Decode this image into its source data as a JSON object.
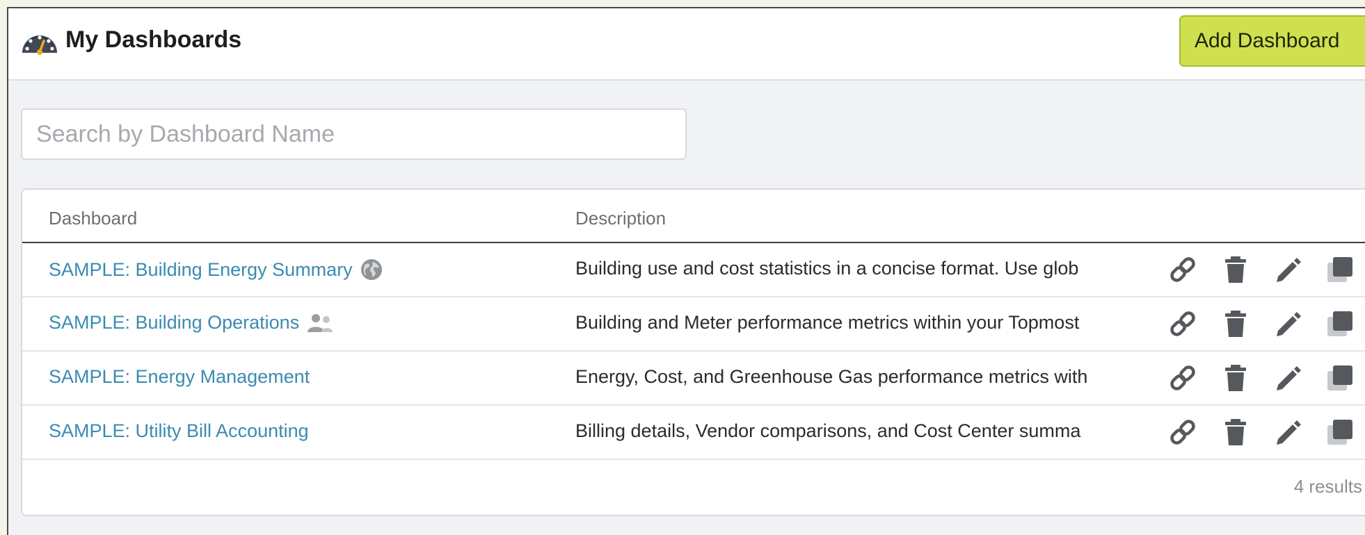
{
  "header": {
    "title": "My Dashboards",
    "add_button_label": "Add Dashboard"
  },
  "search": {
    "placeholder": "Search by Dashboard Name",
    "value": ""
  },
  "table": {
    "columns": [
      "Dashboard",
      "Description"
    ],
    "rows": [
      {
        "name": "SAMPLE: Building Energy Summary",
        "badge_icon": "globe-icon",
        "description": "Building use and cost statistics in a concise format. Use glob"
      },
      {
        "name": "SAMPLE: Building Operations",
        "badge_icon": "users-icon",
        "description": "Building and Meter performance metrics within your Topmost"
      },
      {
        "name": "SAMPLE: Energy Management",
        "badge_icon": "",
        "description": "Energy, Cost, and Greenhouse Gas performance metrics with"
      },
      {
        "name": "SAMPLE: Utility Bill Accounting",
        "badge_icon": "",
        "description": "Billing details, Vendor comparisons, and Cost Center summa"
      }
    ],
    "row_actions": [
      "link-icon",
      "trash-icon",
      "pencil-icon",
      "copy-icon"
    ],
    "results_text": "4 results"
  },
  "colors": {
    "accent_button": "#cfe04f",
    "link_text": "#3a8bb0",
    "action_icon": "#55585c"
  }
}
